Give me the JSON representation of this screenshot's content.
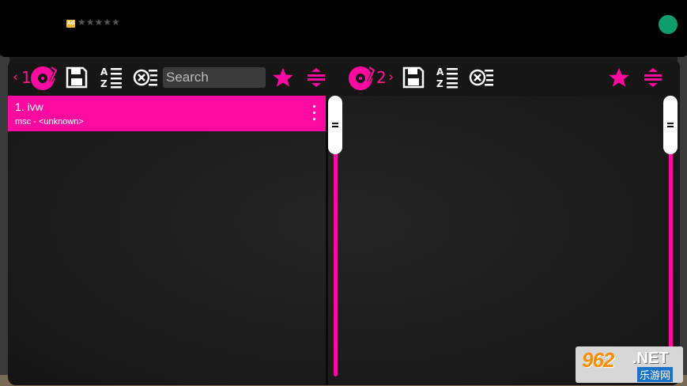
{
  "ad": {
    "badge": "Ad",
    "stars": "★★★★★"
  },
  "toolbar_left": {
    "deck_prev": "‹",
    "deck_number": "1",
    "search_placeholder": "Search"
  },
  "toolbar_right": {
    "deck_number": "2",
    "deck_next": "›"
  },
  "playlist_left": [
    {
      "title": "1. ivw",
      "subtitle": "msc - <unknown>"
    }
  ],
  "watermark": {
    "number": "962",
    "suffix": ".NET",
    "cn": "乐游网"
  },
  "colors": {
    "accent": "#ff0aa1",
    "ad_dot": "#0f9d6f",
    "ad_badge": "#f2b732"
  }
}
